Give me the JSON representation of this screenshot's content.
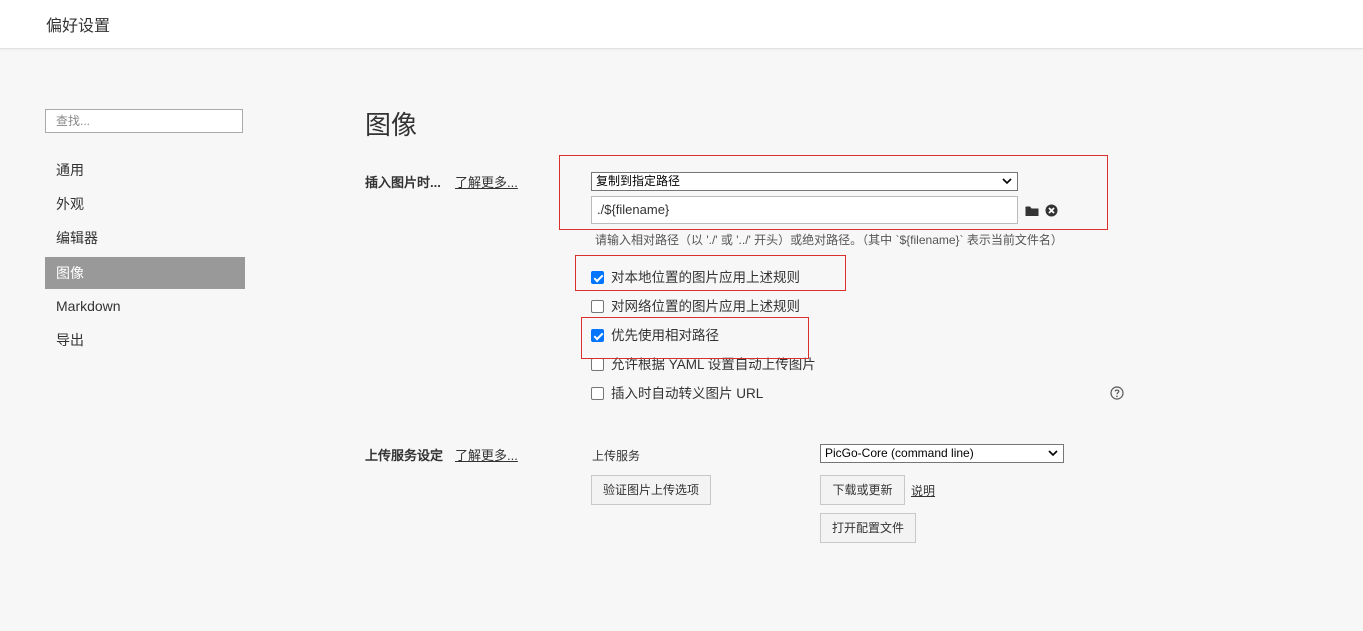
{
  "window": {
    "title": "偏好设置"
  },
  "sidebar": {
    "search_placeholder": "查找...",
    "items": [
      {
        "label": "通用"
      },
      {
        "label": "外观"
      },
      {
        "label": "编辑器"
      },
      {
        "label": "图像",
        "active": true
      },
      {
        "label": "Markdown"
      },
      {
        "label": "导出"
      }
    ]
  },
  "main": {
    "title": "图像",
    "insert_image": {
      "label": "插入图片时...",
      "learn_more": "了解更多...",
      "action_selected": "复制到指定路径",
      "path_value": "./${filename}",
      "hint": "请输入相对路径（以 './' 或 '../' 开头）或绝对路径。（其中 `${filename}` 表示当前文件名）",
      "folder_icon": "folder-icon",
      "clear_icon": "clear-circle-icon",
      "options": [
        {
          "label": "对本地位置的图片应用上述规则",
          "checked": true
        },
        {
          "label": "对网络位置的图片应用上述规则",
          "checked": false
        },
        {
          "label": "优先使用相对路径",
          "checked": true
        },
        {
          "label": "允许根据 YAML 设置自动上传图片",
          "checked": false
        },
        {
          "label": "插入时自动转义图片 URL",
          "checked": false
        }
      ],
      "help_icon": "help-circle-icon"
    },
    "upload": {
      "label": "上传服务设定",
      "learn_more": "了解更多...",
      "service_label": "上传服务",
      "service_selected": "PicGo-Core (command line)",
      "verify_button": "验证图片上传选项",
      "download_button": "下载或更新",
      "explain_link": "说明",
      "open_config_button": "打开配置文件"
    }
  },
  "colors": {
    "highlight_border": "#d9302b",
    "checkbox_checked": "#0075ff",
    "sidebar_active_bg": "#999999"
  }
}
